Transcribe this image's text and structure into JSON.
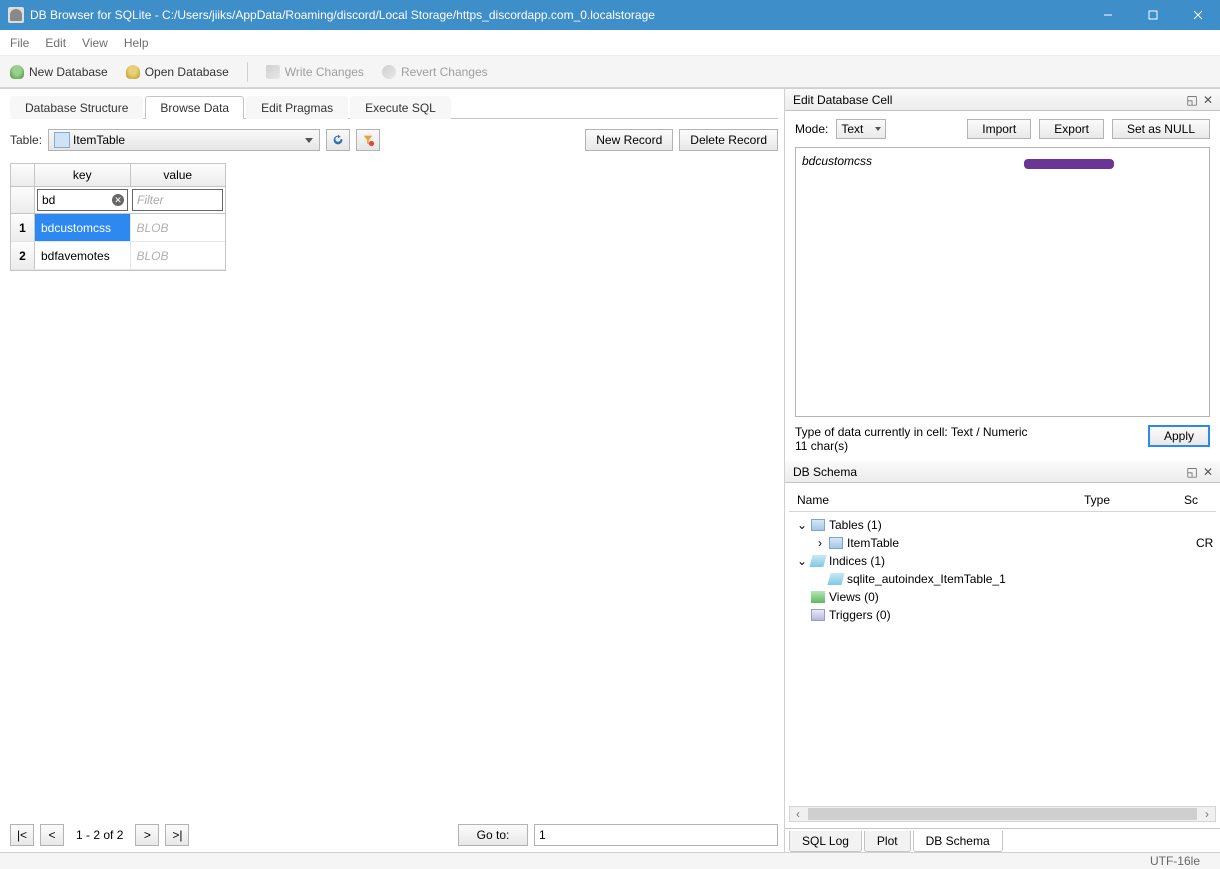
{
  "title": "DB Browser for SQLite - C:/Users/jiiks/AppData/Roaming/discord/Local Storage/https_discordapp.com_0.localstorage",
  "menu": {
    "file": "File",
    "edit": "Edit",
    "view": "View",
    "help": "Help"
  },
  "toolbar": {
    "new_db": "New Database",
    "open_db": "Open Database",
    "write": "Write Changes",
    "revert": "Revert Changes"
  },
  "tabs": {
    "structure": "Database Structure",
    "browse": "Browse Data",
    "pragmas": "Edit Pragmas",
    "sql": "Execute SQL"
  },
  "browse": {
    "table_label": "Table:",
    "table_name": "ItemTable",
    "new_record": "New Record",
    "delete_record": "Delete Record",
    "col_key": "key",
    "col_value": "value",
    "filter_key": "bd",
    "filter_value_ph": "Filter",
    "rows": [
      {
        "n": "1",
        "key": "bdcustomcss",
        "value": "BLOB"
      },
      {
        "n": "2",
        "key": "bdfavemotes",
        "value": "BLOB"
      }
    ],
    "range": "1 - 2 of 2",
    "goto": "Go to:",
    "goto_val": "1"
  },
  "edit_cell": {
    "title": "Edit Database Cell",
    "mode_label": "Mode:",
    "mode_value": "Text",
    "import": "Import",
    "export": "Export",
    "set_null": "Set as NULL",
    "content": "bdcustomcss",
    "type_info": "Type of data currently in cell: Text / Numeric",
    "chars": "11 char(s)",
    "apply": "Apply"
  },
  "schema": {
    "title": "DB Schema",
    "col_name": "Name",
    "col_type": "Type",
    "col_schema": "Sc",
    "tables": "Tables (1)",
    "item_table": "ItemTable",
    "item_table_extra": "CR",
    "indices": "Indices (1)",
    "autoindex": "sqlite_autoindex_ItemTable_1",
    "views": "Views (0)",
    "triggers": "Triggers (0)"
  },
  "bottom_tabs": {
    "sql_log": "SQL Log",
    "plot": "Plot",
    "db_schema": "DB Schema"
  },
  "status": {
    "encoding": "UTF-16le"
  },
  "nav": {
    "first": "|<",
    "prev": "<",
    "next": ">",
    "last": ">|"
  }
}
